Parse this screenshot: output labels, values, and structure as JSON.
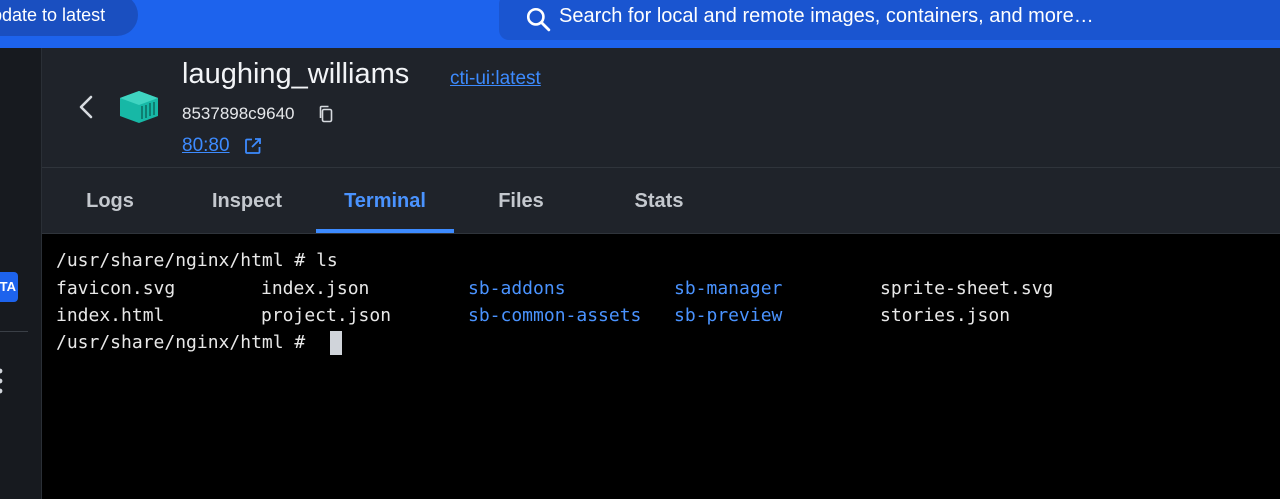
{
  "topbar": {
    "update_label": "pdate to latest",
    "search_placeholder": "Search for local and remote images, containers, and more…"
  },
  "sidebar": {
    "badge": "TA"
  },
  "header": {
    "container_name": "laughing_williams",
    "image_tag": "cti-ui:latest",
    "container_id": "8537898c9640",
    "port": "80:80"
  },
  "tabs": [
    {
      "label": "Logs",
      "active": false
    },
    {
      "label": "Inspect",
      "active": false
    },
    {
      "label": "Terminal",
      "active": true
    },
    {
      "label": "Files",
      "active": false
    },
    {
      "label": "Stats",
      "active": false
    }
  ],
  "terminal": {
    "prompt1": "/usr/share/nginx/html # ls",
    "listing": [
      [
        {
          "name": "favicon.svg",
          "dir": false
        },
        {
          "name": "index.json",
          "dir": false
        },
        {
          "name": "sb-addons",
          "dir": true
        },
        {
          "name": "sb-manager",
          "dir": true
        },
        {
          "name": "sprite-sheet.svg",
          "dir": false
        }
      ],
      [
        {
          "name": "index.html",
          "dir": false
        },
        {
          "name": "project.json",
          "dir": false
        },
        {
          "name": "sb-common-assets",
          "dir": true
        },
        {
          "name": "sb-preview",
          "dir": true
        },
        {
          "name": "stories.json",
          "dir": false
        }
      ]
    ],
    "prompt2": "/usr/share/nginx/html # "
  },
  "colors": {
    "accent": "#1d63ed",
    "link": "#3d8bff",
    "directory": "#4a93ff",
    "panel": "#1f232a",
    "terminal_bg": "#000000"
  },
  "icons": [
    "search-icon",
    "back-icon",
    "container-icon",
    "copy-icon",
    "external-link-icon",
    "more-dots-icon"
  ]
}
